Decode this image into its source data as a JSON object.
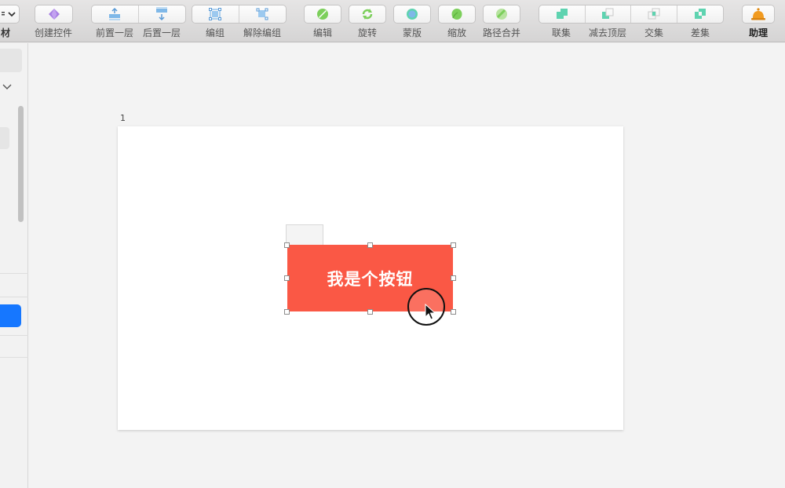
{
  "toolbar": {
    "material_label": "材",
    "create_component": "创建控件",
    "bring_forward": "前置一层",
    "send_backward": "后置一层",
    "group": "编组",
    "ungroup": "解除编组",
    "edit": "编辑",
    "rotate": "旋转",
    "mask": "蒙版",
    "scale": "缩放",
    "merge_path": "路径合并",
    "union": "联集",
    "subtract": "减去顶层",
    "intersect": "交集",
    "difference": "差集",
    "assistant": "助理"
  },
  "canvas": {
    "page_number": "1",
    "button_text": "我是个按钮"
  },
  "colors": {
    "button_red": "#fa5845",
    "accent_blue": "#1677ff",
    "icon_teal": "#5ed3b0",
    "icon_green": "#7ccf5b",
    "icon_purple": "#a77ee3",
    "icon_orange": "#f19a1f"
  },
  "icons": {
    "create_component": "diamond-gem-icon",
    "bring_forward": "layer-up-icon",
    "send_backward": "layer-down-icon",
    "group": "group-icon",
    "ungroup": "ungroup-icon",
    "edit": "edit-shape-icon",
    "rotate": "rotate-icon",
    "mask": "mask-icon",
    "scale": "scale-icon",
    "merge_path": "merge-path-icon",
    "union": "union-icon",
    "subtract": "subtract-icon",
    "intersect": "intersect-icon",
    "difference": "difference-icon",
    "assistant": "bell-icon"
  }
}
